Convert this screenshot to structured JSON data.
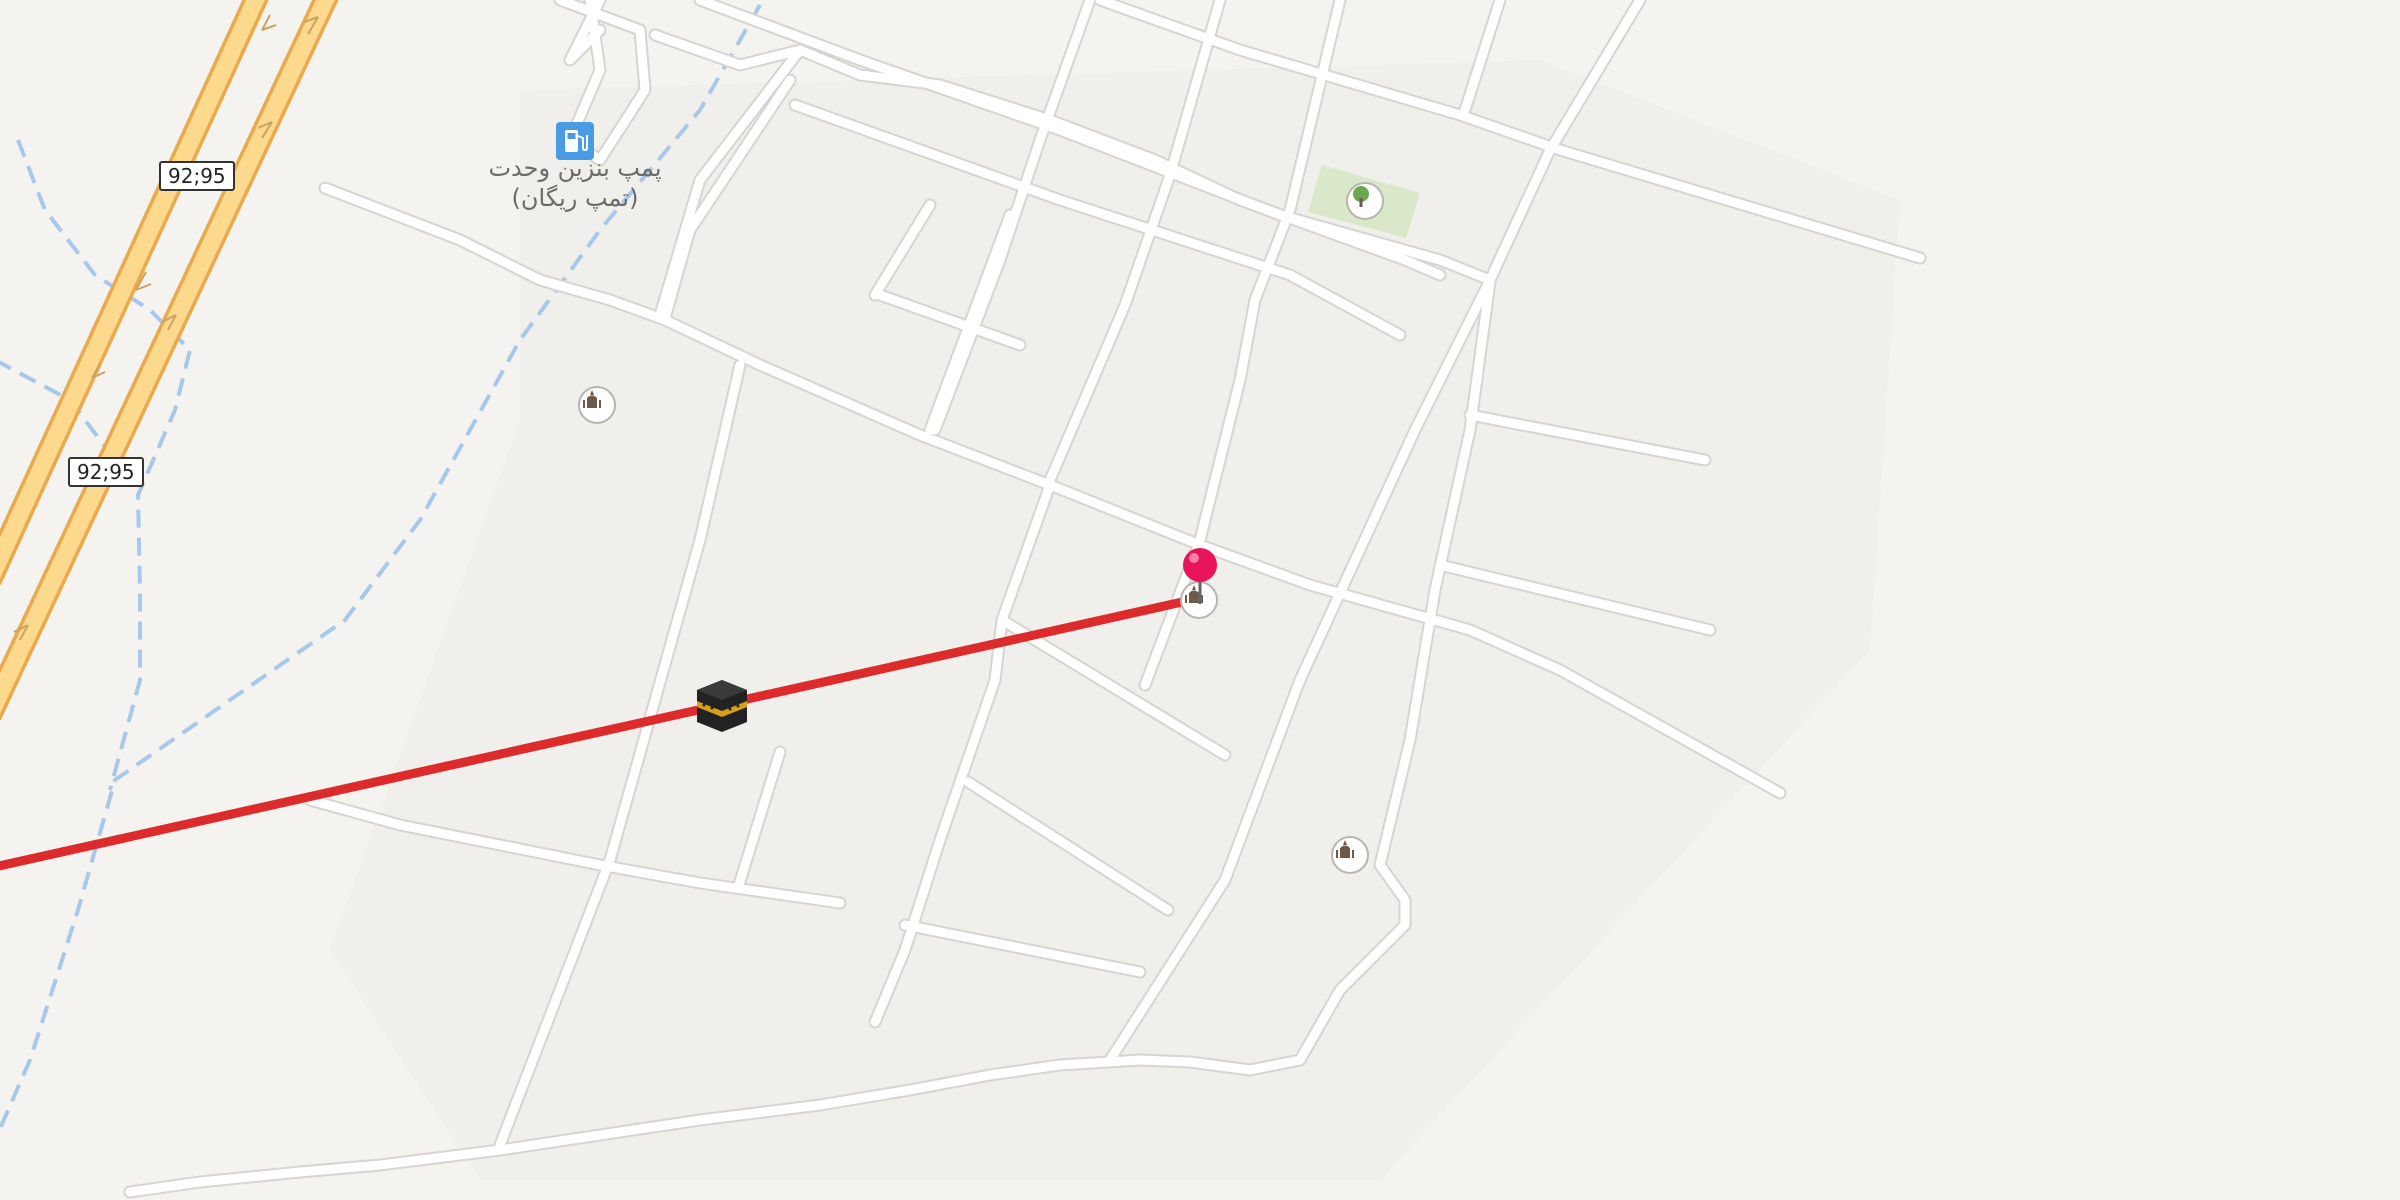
{
  "map": {
    "road_shields": [
      "92;95",
      "92;95"
    ],
    "fuel_station": {
      "icon": "fuel-pump-icon",
      "label_line1": "پمپ بنزین وحدت",
      "label_line2": "(تمپ ریگان)"
    },
    "markers": [
      {
        "icon": "mosque-icon"
      },
      {
        "icon": "mosque-icon"
      },
      {
        "icon": "mosque-icon"
      },
      {
        "icon": "park-tree-icon"
      },
      {
        "icon": "kaaba-icon"
      },
      {
        "icon": "location-pin-icon"
      }
    ],
    "colors": {
      "background": "#f5f3f0",
      "road": "#ffffff",
      "road_casing": "#d8d4cf",
      "highway_fill": "#fcd98d",
      "highway_casing": "#e9a94c",
      "waterway": "#a6c8ec",
      "qibla_line": "#dd2b2b",
      "pin": "#e8145c",
      "park": "#d8e8c8",
      "fuel_icon": "#4a9be6"
    }
  }
}
